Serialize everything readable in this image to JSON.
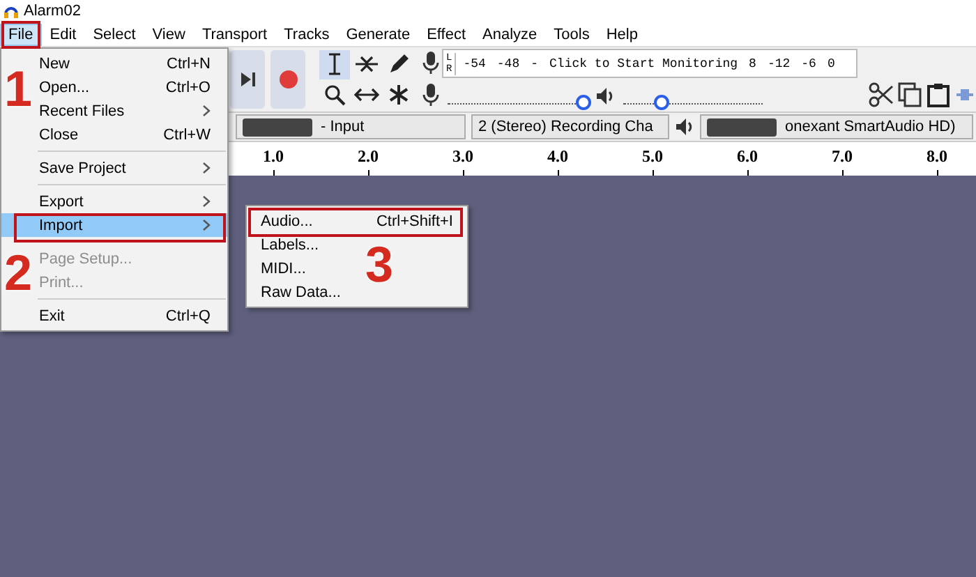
{
  "window": {
    "title": "Alarm02"
  },
  "menu_bar": [
    {
      "label": "File",
      "selected": true
    },
    {
      "label": "Edit",
      "selected": false
    },
    {
      "label": "Select",
      "selected": false
    },
    {
      "label": "View",
      "selected": false
    },
    {
      "label": "Transport",
      "selected": false
    },
    {
      "label": "Tracks",
      "selected": false
    },
    {
      "label": "Generate",
      "selected": false
    },
    {
      "label": "Effect",
      "selected": false
    },
    {
      "label": "Analyze",
      "selected": false
    },
    {
      "label": "Tools",
      "selected": false
    },
    {
      "label": "Help",
      "selected": false
    }
  ],
  "file_menu": [
    {
      "kind": "item",
      "label": "New",
      "shortcut": "Ctrl+N",
      "disabled": false,
      "selected": false
    },
    {
      "kind": "item",
      "label": "Open...",
      "shortcut": "Ctrl+O",
      "disabled": false,
      "selected": false
    },
    {
      "kind": "submenu",
      "label": "Recent Files",
      "disabled": false,
      "selected": false
    },
    {
      "kind": "item",
      "label": "Close",
      "shortcut": "Ctrl+W",
      "disabled": false,
      "selected": false
    },
    {
      "kind": "separator"
    },
    {
      "kind": "submenu",
      "label": "Save Project",
      "disabled": false,
      "selected": false
    },
    {
      "kind": "separator"
    },
    {
      "kind": "submenu",
      "label": "Export",
      "disabled": false,
      "selected": false
    },
    {
      "kind": "submenu",
      "label": "Import",
      "disabled": false,
      "selected": true
    },
    {
      "kind": "separator"
    },
    {
      "kind": "item",
      "label": "Page Setup...",
      "disabled": true,
      "selected": false
    },
    {
      "kind": "item",
      "label": "Print...",
      "disabled": true,
      "selected": false
    },
    {
      "kind": "separator"
    },
    {
      "kind": "item",
      "label": "Exit",
      "shortcut": "Ctrl+Q",
      "disabled": false,
      "selected": false
    }
  ],
  "import_submenu": [
    {
      "label": "Audio...",
      "shortcut": "Ctrl+Shift+I"
    },
    {
      "label": "Labels..."
    },
    {
      "label": "MIDI..."
    },
    {
      "label": "Raw Data..."
    }
  ],
  "toolbar": {
    "meter_channels": [
      "L",
      "R"
    ],
    "meter_ticks": [
      "-54",
      "-48",
      "-",
      "Click to Start Monitoring",
      "8",
      "-12",
      "-6",
      "0"
    ],
    "recording_volume": {
      "level": 0.97
    },
    "playback_volume": {
      "level": 0.27
    }
  },
  "devices": {
    "recording_device": "- Input",
    "channels": "2 (Stereo) Recording Cha",
    "playback_device": "onexant SmartAudio HD)"
  },
  "timeline": {
    "ticks": [
      "1.0",
      "2.0",
      "3.0",
      "4.0",
      "5.0",
      "6.0",
      "7.0",
      "8.0"
    ]
  },
  "annotations": [
    {
      "label": "1"
    },
    {
      "label": "2"
    },
    {
      "label": "3"
    }
  ]
}
